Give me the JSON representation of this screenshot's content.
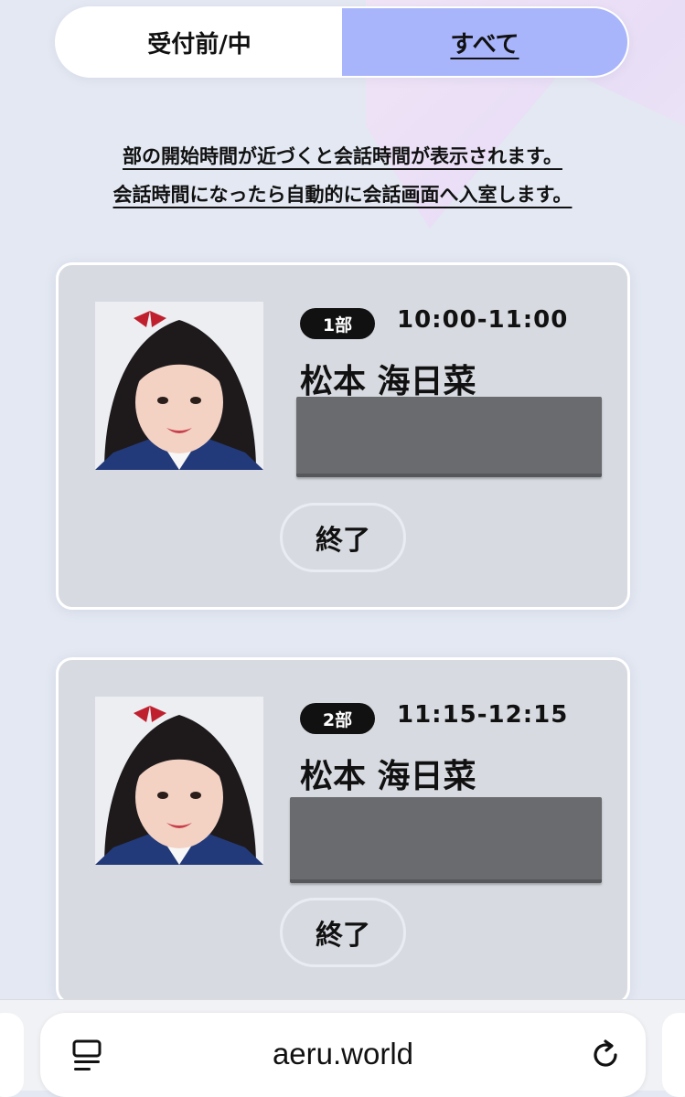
{
  "tabs": {
    "pending": "受付前/中",
    "all": "すべて"
  },
  "notice": {
    "line1": "部の開始時間が近づくと会話時間が表示されます。",
    "line2": "会話時間になったら自動的に会話画面へ入室します。"
  },
  "sessions": [
    {
      "part": "1部",
      "time": "10:00-11:00",
      "name": "松本 海日菜",
      "button": "終了"
    },
    {
      "part": "2部",
      "time": "11:15-12:15",
      "name": "松本 海日菜",
      "button": "終了"
    }
  ],
  "browser": {
    "url": "aeru.world"
  },
  "colors": {
    "accent_tab": "#a8b5fb",
    "card_bg": "#d7dae0",
    "page_bg": "#e3e8f2"
  }
}
